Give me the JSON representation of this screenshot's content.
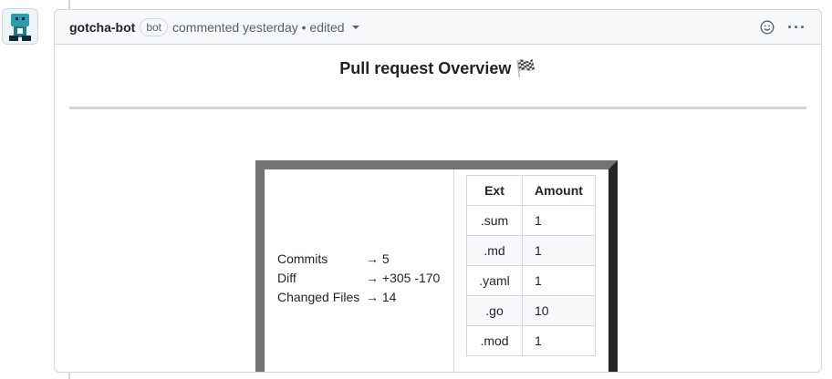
{
  "comment": {
    "author": "gotcha-bot",
    "badge": "bot",
    "meta": "commented yesterday • edited",
    "icons": [
      "smiley-icon",
      "kebab-icon",
      "caret-down-icon"
    ]
  },
  "body": {
    "title": "Pull request Overview 🏁",
    "stats": [
      {
        "name": "Commits",
        "value": "→ 5"
      },
      {
        "name": "Diff",
        "value": "→ +305 -170"
      },
      {
        "name": "Changed Files",
        "value": "→ 14"
      }
    ],
    "ext_table": {
      "headers": [
        "Ext",
        "Amount"
      ],
      "rows": [
        {
          "ext": ".sum",
          "amount": "1"
        },
        {
          "ext": ".md",
          "amount": "1"
        },
        {
          "ext": ".yaml",
          "amount": "1"
        },
        {
          "ext": ".go",
          "amount": "10"
        },
        {
          "ext": ".mod",
          "amount": "1"
        }
      ]
    }
  }
}
